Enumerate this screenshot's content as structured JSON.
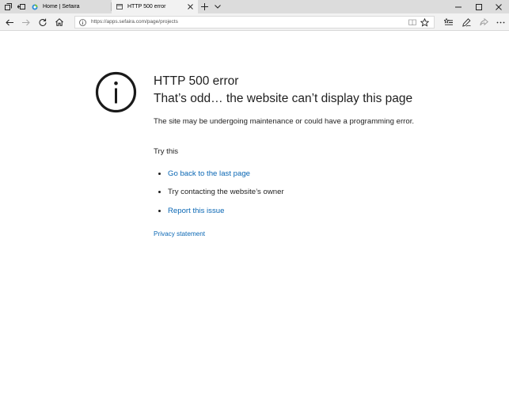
{
  "tabs": [
    {
      "label": "Home | Sefaira",
      "active": false
    },
    {
      "label": "HTTP 500 error",
      "active": true
    }
  ],
  "address": {
    "url": "https://apps.sefaira.com/page/projects"
  },
  "error": {
    "code": "HTTP 500 error",
    "title": "That’s odd… the website can’t display this page",
    "description": "The site may be undergoing maintenance or could have a programming error.",
    "try_label": "Try this",
    "suggestions": [
      {
        "text": "Go back to the last page",
        "link": true
      },
      {
        "text": "Try contacting the website’s owner",
        "link": false
      },
      {
        "text": "Report this issue",
        "link": true
      }
    ],
    "privacy": "Privacy statement"
  },
  "colors": {
    "link": "#0a67b4",
    "tabbar": "#dcdcdc",
    "toolbar": "#f2f2f2"
  },
  "icons": {
    "tab_sets": "tab-sets-icon",
    "set_aside": "set-aside-tabs-icon",
    "new_tab": "plus-icon",
    "tab_preview": "chevron-down-icon",
    "back": "back-arrow-icon",
    "forward": "forward-arrow-icon",
    "refresh": "refresh-icon",
    "home": "home-icon",
    "favorites_hub": "favorites-hub-icon",
    "notes": "pen-icon",
    "share": "share-icon",
    "more": "more-icon",
    "error": "info-circle-icon"
  }
}
